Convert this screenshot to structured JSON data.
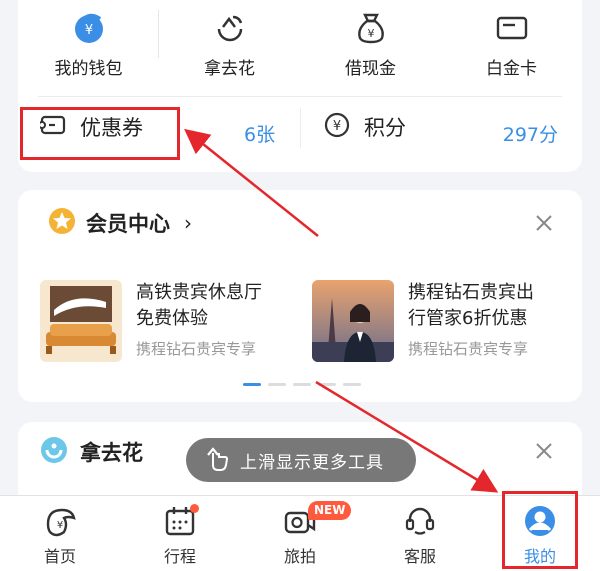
{
  "wallet": {
    "items": [
      {
        "label": "我的钱包",
        "icon": "wallet-icon"
      },
      {
        "label": "拿去花",
        "icon": "naquhua-icon"
      },
      {
        "label": "借现金",
        "icon": "money-bag-icon"
      },
      {
        "label": "白金卡",
        "icon": "card-icon"
      }
    ],
    "coupon": {
      "label": "优惠券",
      "count": "6张",
      "icon": "coupon-icon"
    },
    "points": {
      "label": "积分",
      "count": "297分",
      "icon": "yen-circle-icon"
    }
  },
  "member": {
    "title": "会员中心",
    "chevron": "›",
    "promos": [
      {
        "line1": "高铁贵宾休息厅",
        "line2": "免费体验",
        "sub": "携程钻石贵宾专享"
      },
      {
        "line1": "携程钻石贵宾出",
        "line2": "行管家6折优惠",
        "sub": "携程钻石贵宾专享"
      }
    ]
  },
  "naqu": {
    "title": "拿去花"
  },
  "toast": {
    "text": "上滑显示更多工具"
  },
  "tabbar": {
    "items": [
      {
        "label": "首页",
        "icon": "home-dolphin-icon"
      },
      {
        "label": "行程",
        "icon": "calendar-icon"
      },
      {
        "label": "旅拍",
        "icon": "video-camera-icon",
        "badge": "NEW"
      },
      {
        "label": "客服",
        "icon": "headset-icon"
      },
      {
        "label": "我的",
        "icon": "profile-icon"
      }
    ]
  },
  "colors": {
    "accent": "#3a8ee6",
    "annotation": "#e4272c",
    "badge": "#ff5a3d"
  }
}
